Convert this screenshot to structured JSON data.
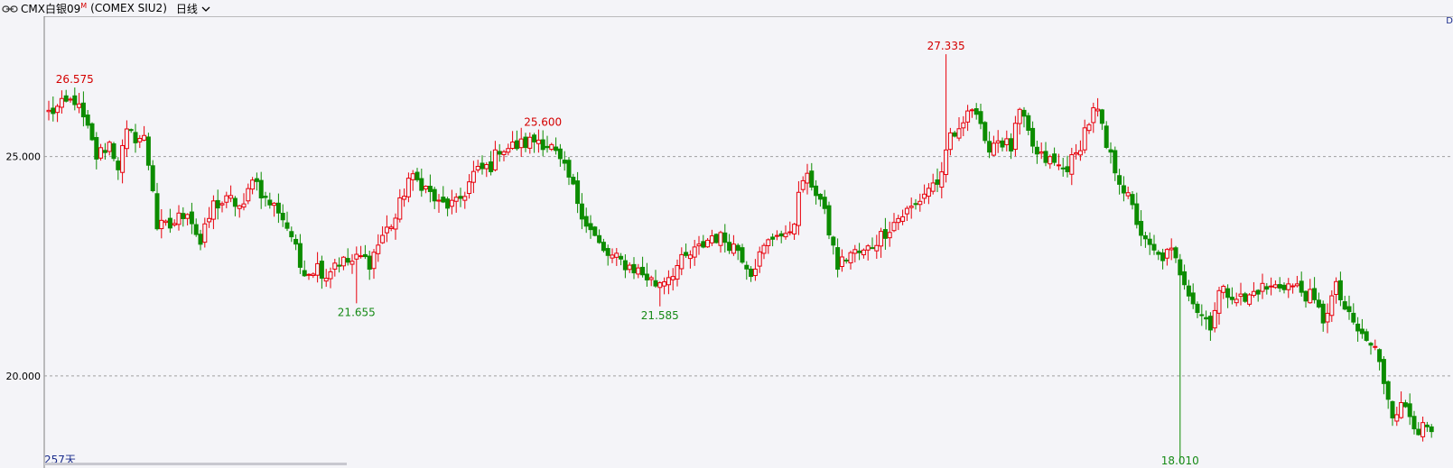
{
  "toolbar": {
    "icon": "link-icon",
    "symbol_prefix": "CMX白银09",
    "symbol_sup": "M",
    "name": "(COMEX SIU2)",
    "period": "日线",
    "period_icon": "chevron-down-icon"
  },
  "corner_text": "D",
  "day_count": "257天",
  "colors": {
    "up": "#e8000b",
    "down": "#0c8c00",
    "grid": "#a0a0a0",
    "axis": "#808080",
    "label_up": "#d40000",
    "label_down": "#168a16"
  },
  "chart_data": {
    "type": "candlestick",
    "y_ticks": [
      "25.000",
      "20.000"
    ],
    "ylim": [
      17.9,
      28.2
    ],
    "annotations": [
      {
        "label": "26.575",
        "kind": "high",
        "index": 6
      },
      {
        "label": "21.655",
        "kind": "low",
        "index": 71
      },
      {
        "label": "25.600",
        "kind": "high",
        "index": 114
      },
      {
        "label": "21.585",
        "kind": "low",
        "index": 141
      },
      {
        "label": "27.335",
        "kind": "high",
        "index": 207
      },
      {
        "label": "18.010",
        "kind": "low",
        "index": 261
      }
    ],
    "anchors": [
      [
        0,
        26.0
      ],
      [
        6,
        26.3
      ],
      [
        9,
        25.6
      ],
      [
        11,
        25.0
      ],
      [
        14,
        25.3
      ],
      [
        16,
        24.8
      ],
      [
        18,
        25.5
      ],
      [
        22,
        25.4
      ],
      [
        24,
        24.3
      ],
      [
        25,
        23.4
      ],
      [
        28,
        23.4
      ],
      [
        32,
        23.8
      ],
      [
        35,
        23.0
      ],
      [
        38,
        23.9
      ],
      [
        42,
        24.0
      ],
      [
        45,
        23.8
      ],
      [
        47,
        24.6
      ],
      [
        50,
        24.0
      ],
      [
        53,
        23.8
      ],
      [
        56,
        23.2
      ],
      [
        58,
        22.5
      ],
      [
        60,
        22.4
      ],
      [
        62,
        22.5
      ],
      [
        64,
        22.3
      ],
      [
        66,
        22.6
      ],
      [
        70,
        22.6
      ],
      [
        72,
        22.7
      ],
      [
        74,
        22.6
      ],
      [
        77,
        23.2
      ],
      [
        80,
        23.6
      ],
      [
        83,
        24.5
      ],
      [
        86,
        24.4
      ],
      [
        90,
        23.9
      ],
      [
        94,
        23.9
      ],
      [
        96,
        24.2
      ],
      [
        98,
        24.6
      ],
      [
        102,
        24.8
      ],
      [
        104,
        25.2
      ],
      [
        106,
        25.2
      ],
      [
        110,
        25.3
      ],
      [
        113,
        25.4
      ],
      [
        116,
        25.2
      ],
      [
        120,
        24.5
      ],
      [
        124,
        23.5
      ],
      [
        128,
        22.8
      ],
      [
        132,
        22.6
      ],
      [
        136,
        22.4
      ],
      [
        140,
        22.1
      ],
      [
        143,
        22.3
      ],
      [
        146,
        22.6
      ],
      [
        150,
        22.9
      ],
      [
        153,
        23.2
      ],
      [
        156,
        23.1
      ],
      [
        159,
        22.9
      ],
      [
        162,
        22.4
      ],
      [
        165,
        22.9
      ],
      [
        168,
        23.3
      ],
      [
        170,
        23.1
      ],
      [
        172,
        23.6
      ],
      [
        174,
        24.5
      ],
      [
        176,
        24.4
      ],
      [
        178,
        24.0
      ],
      [
        180,
        23.3
      ],
      [
        182,
        22.5
      ],
      [
        185,
        22.8
      ],
      [
        188,
        22.8
      ],
      [
        192,
        23.2
      ],
      [
        196,
        23.6
      ],
      [
        200,
        23.9
      ],
      [
        203,
        24.3
      ],
      [
        206,
        24.5
      ],
      [
        208,
        25.5
      ],
      [
        210,
        25.5
      ],
      [
        212,
        26.2
      ],
      [
        214,
        26.0
      ],
      [
        216,
        25.2
      ],
      [
        219,
        25.4
      ],
      [
        222,
        25.2
      ],
      [
        224,
        26.0
      ],
      [
        226,
        25.5
      ],
      [
        228,
        25.0
      ],
      [
        231,
        24.9
      ],
      [
        234,
        24.7
      ],
      [
        237,
        25.0
      ],
      [
        239,
        25.6
      ],
      [
        241,
        26.0
      ],
      [
        242,
        26.0
      ],
      [
        244,
        25.2
      ],
      [
        247,
        24.5
      ],
      [
        250,
        23.8
      ],
      [
        253,
        23.0
      ],
      [
        256,
        22.7
      ],
      [
        259,
        22.8
      ],
      [
        262,
        22.2
      ],
      [
        265,
        21.5
      ],
      [
        268,
        21.2
      ],
      [
        270,
        21.9
      ],
      [
        273,
        21.9
      ],
      [
        276,
        21.7
      ],
      [
        279,
        22.0
      ],
      [
        282,
        22.0
      ],
      [
        285,
        22.1
      ],
      [
        288,
        22.0
      ],
      [
        291,
        21.8
      ],
      [
        294,
        21.3
      ],
      [
        297,
        22.0
      ],
      [
        300,
        21.3
      ],
      [
        303,
        20.9
      ],
      [
        306,
        20.6
      ],
      [
        308,
        19.9
      ],
      [
        310,
        19.2
      ],
      [
        313,
        19.3
      ],
      [
        316,
        18.8
      ],
      [
        319,
        18.7
      ]
    ]
  }
}
